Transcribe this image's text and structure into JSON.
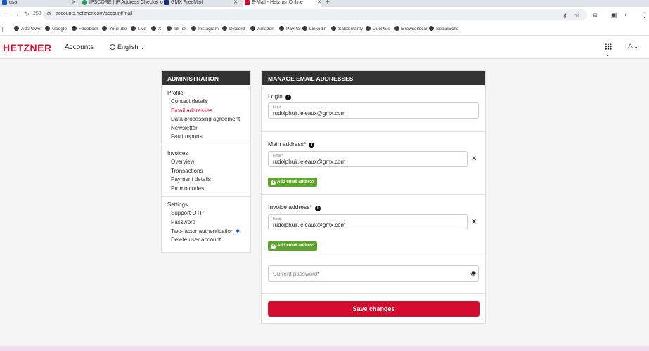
{
  "browser": {
    "tabs": [
      {
        "title": "usa",
        "fav_color": "#1a55c9"
      },
      {
        "title": "IPSCORE | IP Address Checker o",
        "fav_color": "#2a9d60"
      },
      {
        "title": "GMX FreeMail",
        "fav_color": "#1c2f7a"
      },
      {
        "title": "E-Mail - Hetzner Online",
        "fav_color": "#d50c2d"
      }
    ],
    "badge_count": "258",
    "url": "accounts.hetzner.com/account/mail",
    "bookmarks": [
      "AdsPower",
      "Google",
      "Facebook",
      "YouTube",
      "Live",
      "X",
      "TikTok",
      "Instagram",
      "Discord",
      "Amazon",
      "PayPal",
      "Linkedin",
      "SaleSmartly",
      "DuoPlus",
      "BrowserScan",
      "SocialEcho"
    ]
  },
  "header": {
    "logo": "HETZNER",
    "app_name": "Accounts",
    "language": "English"
  },
  "sidebar": {
    "title": "ADMINISTRATION",
    "sections": [
      {
        "title": "Profile",
        "items": [
          "Contact details",
          "Email addresses",
          "Data processing agreement",
          "Newsletter",
          "Fault reports"
        ]
      },
      {
        "title": "Invoices",
        "items": [
          "Overview",
          "Transactions",
          "Payment details",
          "Promo codes"
        ]
      },
      {
        "title": "Settings",
        "items": [
          "Support OTP",
          "Password",
          "Two-factor authentication",
          "Delete user account"
        ]
      }
    ],
    "active_item": "Email addresses"
  },
  "main": {
    "title": "MANAGE EMAIL ADDRESSES",
    "login": {
      "label": "Login",
      "field_label": "Login",
      "value": "rudolphujr.leleaux@gmx.com"
    },
    "main_address": {
      "label": "Main address*",
      "field_label": "Email*",
      "value": "rudolphujr.leleaux@gmx.com",
      "add_button": "Add email address"
    },
    "invoice_address": {
      "label": "Invoice address*",
      "field_label": "Email",
      "value": "rudolphujr.leleaux@gmx.com",
      "add_button": "Add email address"
    },
    "password": {
      "placeholder": "Current password",
      "required_mark": "*"
    },
    "save_button": "Save changes"
  },
  "colors": {
    "brand": "#d50c2d",
    "add_button": "#5da52b",
    "header_dark": "#333333"
  }
}
